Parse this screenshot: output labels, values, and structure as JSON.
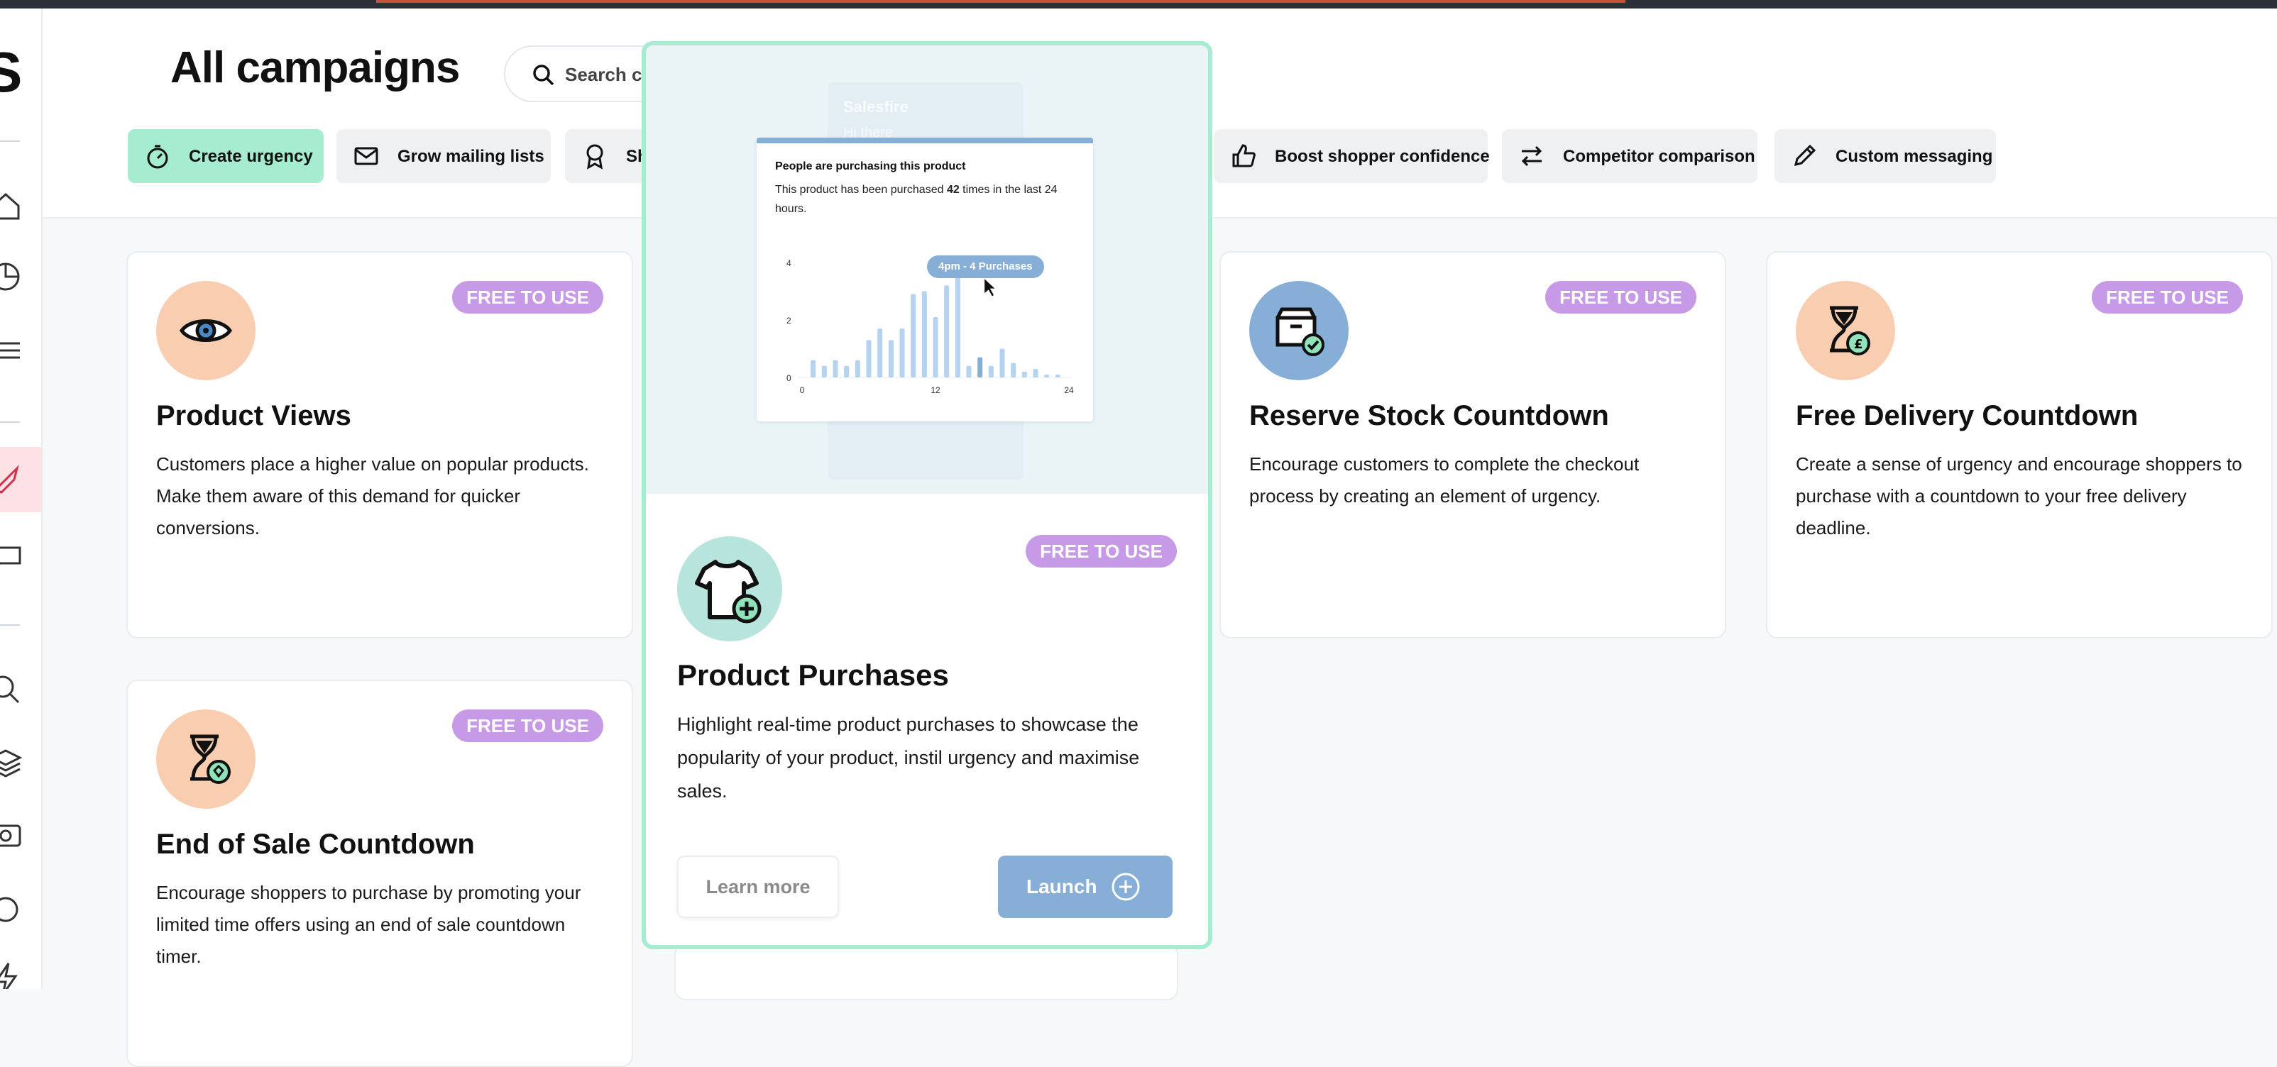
{
  "header": {
    "title": "All campaigns",
    "search_placeholder": "Search campa"
  },
  "filters": [
    {
      "label": "Create urgency",
      "icon": "stopwatch-icon",
      "active": true
    },
    {
      "label": "Grow mailing lists",
      "icon": "envelope-icon"
    },
    {
      "label": "Sh",
      "icon": "award-icon"
    },
    {
      "label": "Boost shopper confidence",
      "icon": "thumbs-up-icon"
    },
    {
      "label": "Competitor comparison",
      "icon": "arrows-swap-icon"
    },
    {
      "label": "Custom messaging",
      "icon": "pencil-icon"
    }
  ],
  "cards": [
    {
      "title": "Product Views",
      "badge": "FREE TO USE",
      "icon": "eye-icon",
      "description": "Customers place a higher value on popular products. Make them aware of this demand for quicker conversions."
    },
    {
      "title": "Reserve Stock Countdown",
      "badge": "FREE TO USE",
      "icon": "box-check-icon",
      "description": "Encourage customers to complete the checkout process by creating an element of urgency."
    },
    {
      "title": "Free Delivery Countdown",
      "badge": "FREE TO USE",
      "icon": "hourglass-pound-icon",
      "description": "Create a sense of urgency and encourage shoppers to purchase with a countdown to your free delivery deadline."
    },
    {
      "title": "End of Sale Countdown",
      "badge": "FREE TO USE",
      "icon": "hourglass-tag-icon",
      "description": "Encourage shoppers to purchase by promoting your limited time offers using an end of sale countdown timer."
    }
  ],
  "modal": {
    "title": "Product Purchases",
    "badge": "FREE TO USE",
    "icon": "tshirt-plus-icon",
    "description": "Highlight real-time product purchases to showcase the popularity of your product, instil urgency and maximise sales.",
    "learn_more": "Learn more",
    "launch": "Launch",
    "preview": {
      "brand": "Salesfire",
      "greeting": "Hi there",
      "heading": "People are purchasing this product",
      "body_before": "This product has been purchased ",
      "count": "42",
      "body_after": " times in the last 24 hours.",
      "tooltip": "4pm - 4 Purchases",
      "y_ticks": [
        "4",
        "2",
        "0"
      ],
      "x_ticks": [
        "0",
        "12",
        "24"
      ]
    }
  },
  "chart_data": {
    "type": "bar",
    "x": [
      1,
      2,
      3,
      4,
      5,
      6,
      7,
      8,
      9,
      10,
      11,
      12,
      13,
      14,
      15,
      16,
      17,
      18,
      19,
      20,
      21,
      22,
      23
    ],
    "values": [
      0.6,
      0.4,
      0.6,
      0.4,
      0.6,
      1.3,
      1.7,
      1.3,
      1.7,
      2.9,
      3.0,
      2.1,
      3.2,
      3.7,
      0.4,
      0.7,
      0.4,
      1.0,
      0.5,
      0.2,
      0.3,
      0.1,
      0.1
    ],
    "highlight_x": 16,
    "ylim": [
      0,
      4
    ],
    "xlim": [
      0,
      24
    ],
    "colors": {
      "bar": "#b5d3f0",
      "highlight": "#86aed6"
    }
  },
  "colors": {
    "badge": "#c79ae8",
    "active_chip": "#a5ecd0",
    "launch": "#86aed6"
  }
}
